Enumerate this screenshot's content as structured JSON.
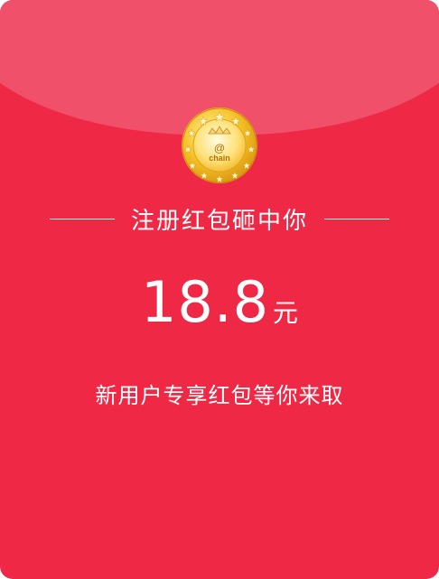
{
  "envelope": {
    "headline": "注册红包砸中你",
    "amount": "18.8",
    "unit": "元",
    "subtitle": "新用户专享红包等你来取"
  },
  "coin": {
    "symbol": "@",
    "brand": "chain"
  },
  "colors": {
    "body": "#ee2845",
    "flap": "#f0506a",
    "coin_gold": "#f7c52b",
    "text": "#ffffff"
  }
}
